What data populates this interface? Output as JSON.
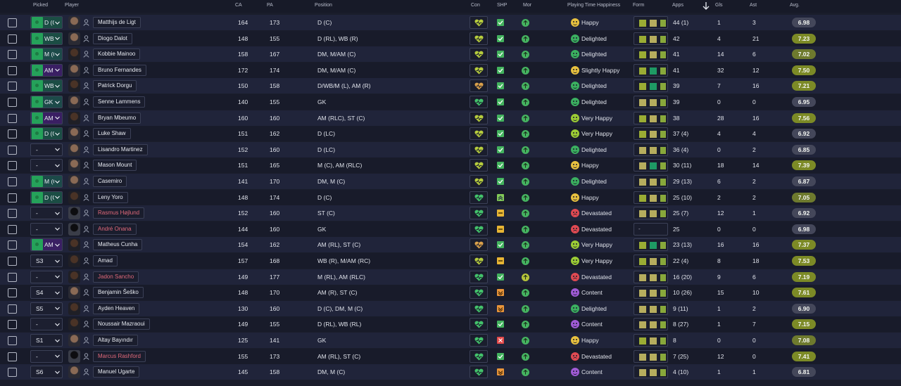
{
  "columns": {
    "picked": "Picked",
    "player": "Player",
    "ca": "CA",
    "pa": "PA",
    "position": "Position",
    "con": "Con",
    "shp": "SHP",
    "mor": "Mor",
    "happiness": "Playing Time Happiness",
    "form": "Form",
    "apps": "Apps",
    "gls": "Gls",
    "ast": "Ast",
    "avg": "Avg."
  },
  "sort": {
    "column": "apps",
    "direction": "descending"
  },
  "rows": [
    {
      "picked": "D (C",
      "picked_type": "d",
      "name": "Matthijs de Ligt",
      "name_red": false,
      "face": "light",
      "ca": "164",
      "pa": "173",
      "position": "D (C)",
      "con": "yellow-green",
      "shp": "ok",
      "mor": "g",
      "happiness": "Happy",
      "hap": "happy",
      "form": [
        "fg",
        "fy",
        "fl"
      ],
      "apps": "44 (1)",
      "gls": "1",
      "ast": "3",
      "avg": "6.98",
      "avg_level": "lo"
    },
    {
      "picked": "WB",
      "picked_type": "wb",
      "name": "Diogo Dalot",
      "name_red": false,
      "face": "light",
      "ca": "148",
      "pa": "155",
      "position": "D (RL), WB (R)",
      "con": "yellow-green",
      "shp": "ok",
      "mor": "g",
      "happiness": "Delighted",
      "hap": "delighted",
      "form": [
        "fg",
        "fy",
        "fl"
      ],
      "apps": "42",
      "gls": "4",
      "ast": "21",
      "avg": "7.23",
      "avg_level": "hi"
    },
    {
      "picked": "M (C",
      "picked_type": "m",
      "name": "Kobbie Mainoo",
      "name_red": false,
      "face": "dark",
      "ca": "158",
      "pa": "167",
      "position": "DM, M/AM (C)",
      "con": "yellow-green",
      "shp": "ok",
      "mor": "g",
      "happiness": "Delighted",
      "hap": "delighted",
      "form": [
        "fg",
        "fy",
        "fl"
      ],
      "apps": "41",
      "gls": "14",
      "ast": "6",
      "avg": "7.02",
      "avg_level": "mid"
    },
    {
      "picked": "AM",
      "picked_type": "am",
      "name": "Bruno Fernandes",
      "name_red": false,
      "face": "light",
      "ca": "172",
      "pa": "174",
      "position": "DM, M/AM (C)",
      "con": "yellow-green",
      "shp": "ok",
      "mor": "g",
      "happiness": "Slightly Happy",
      "hap": "slightly",
      "form": [
        "fg",
        "fd",
        "fl"
      ],
      "apps": "41",
      "gls": "32",
      "ast": "12",
      "avg": "7.50",
      "avg_level": "hi"
    },
    {
      "picked": "WB",
      "picked_type": "wb",
      "name": "Patrick Dorgu",
      "name_red": false,
      "face": "dark",
      "ca": "150",
      "pa": "158",
      "position": "D/WB/M (L), AM (R)",
      "con": "orange",
      "shp": "ok",
      "mor": "g",
      "happiness": "Delighted",
      "hap": "delighted",
      "form": [
        "fg",
        "fd",
        "fl"
      ],
      "apps": "39",
      "gls": "7",
      "ast": "16",
      "avg": "7.21",
      "avg_level": "hi"
    },
    {
      "picked": "GK",
      "picked_type": "gk",
      "name": "Senne Lammens",
      "name_red": false,
      "face": "light",
      "ca": "140",
      "pa": "155",
      "position": "GK",
      "con": "green",
      "shp": "ok",
      "mor": "g",
      "happiness": "Delighted",
      "hap": "delighted",
      "form": [
        "fy",
        "fy",
        "fl"
      ],
      "apps": "39",
      "gls": "0",
      "ast": "0",
      "avg": "6.95",
      "avg_level": "lo"
    },
    {
      "picked": "AM",
      "picked_type": "am",
      "name": "Bryan Mbeumo",
      "name_red": false,
      "face": "dark",
      "ca": "160",
      "pa": "160",
      "position": "AM (RLC), ST (C)",
      "con": "yellow-green",
      "shp": "ok",
      "mor": "g",
      "happiness": "Very Happy",
      "hap": "veryhappy",
      "form": [
        "fg",
        "fy",
        "fl"
      ],
      "apps": "38",
      "gls": "28",
      "ast": "16",
      "avg": "7.56",
      "avg_level": "hi"
    },
    {
      "picked": "D (C",
      "picked_type": "d",
      "name": "Luke Shaw",
      "name_red": false,
      "face": "light",
      "ca": "151",
      "pa": "162",
      "position": "D (LC)",
      "con": "yellow-green",
      "shp": "ok",
      "mor": "g",
      "happiness": "Very Happy",
      "hap": "veryhappy",
      "form": [
        "fg",
        "fy",
        "fl"
      ],
      "apps": "37 (4)",
      "gls": "4",
      "ast": "4",
      "avg": "6.92",
      "avg_level": "lo"
    },
    {
      "picked": "-",
      "picked_type": "empty",
      "name": "Lisandro Martinez",
      "name_red": false,
      "face": "light",
      "ca": "152",
      "pa": "160",
      "position": "D (LC)",
      "con": "yellow-green",
      "shp": "ok",
      "mor": "g",
      "happiness": "Delighted",
      "hap": "delighted",
      "form": [
        "fy",
        "fy",
        "fl"
      ],
      "apps": "36 (4)",
      "gls": "0",
      "ast": "2",
      "avg": "6.85",
      "avg_level": "lo"
    },
    {
      "picked": "-",
      "picked_type": "empty",
      "name": "Mason Mount",
      "name_red": false,
      "face": "light",
      "ca": "151",
      "pa": "165",
      "position": "M (C), AM (RLC)",
      "con": "yellow-green",
      "shp": "ok",
      "mor": "g",
      "happiness": "Happy",
      "hap": "happy",
      "form": [
        "fy",
        "fd",
        "fl"
      ],
      "apps": "30 (11)",
      "gls": "18",
      "ast": "14",
      "avg": "7.39",
      "avg_level": "hi"
    },
    {
      "picked": "M (C",
      "picked_type": "m",
      "name": "Casemiro",
      "name_red": false,
      "face": "light",
      "ca": "141",
      "pa": "170",
      "position": "DM, M (C)",
      "con": "yellow-green",
      "shp": "ok",
      "mor": "g",
      "happiness": "Delighted",
      "hap": "delighted",
      "form": [
        "fy",
        "fy",
        "fl"
      ],
      "apps": "29 (13)",
      "gls": "6",
      "ast": "2",
      "avg": "6.87",
      "avg_level": "lo"
    },
    {
      "picked": "D (C",
      "picked_type": "d",
      "name": "Leny Yoro",
      "name_red": false,
      "face": "dark",
      "ca": "148",
      "pa": "174",
      "position": "D (C)",
      "con": "green",
      "shp": "up",
      "mor": "g",
      "happiness": "Happy",
      "hap": "happy",
      "form": [
        "fg",
        "fy",
        "fl"
      ],
      "apps": "25 (10)",
      "gls": "2",
      "ast": "2",
      "avg": "7.05",
      "avg_level": "mid"
    },
    {
      "picked": "-",
      "picked_type": "empty",
      "name": "Rasmus Højlund",
      "name_red": true,
      "face": "sil",
      "ca": "152",
      "pa": "160",
      "position": "ST (C)",
      "con": "green",
      "shp": "mid",
      "mor": "g",
      "happiness": "Devastated",
      "hap": "devastated",
      "form": [
        "fy",
        "fy",
        "fl"
      ],
      "apps": "25 (7)",
      "gls": "12",
      "ast": "1",
      "avg": "6.92",
      "avg_level": "lo"
    },
    {
      "picked": "-",
      "picked_type": "empty",
      "name": "André Onana",
      "name_red": true,
      "face": "sil",
      "ca": "144",
      "pa": "160",
      "position": "GK",
      "con": "green",
      "shp": "mid",
      "mor": "g",
      "happiness": "Devastated",
      "hap": "devastated",
      "form": [],
      "apps": "25",
      "gls": "0",
      "ast": "0",
      "avg": "6.98",
      "avg_level": "lo"
    },
    {
      "picked": "AM",
      "picked_type": "am",
      "name": "Matheus Cunha",
      "name_red": false,
      "face": "dark",
      "ca": "154",
      "pa": "162",
      "position": "AM (RL), ST (C)",
      "con": "orange",
      "shp": "ok",
      "mor": "g",
      "happiness": "Very Happy",
      "hap": "veryhappy",
      "form": [
        "fg",
        "fd",
        "fl"
      ],
      "apps": "23 (13)",
      "gls": "16",
      "ast": "16",
      "avg": "7.37",
      "avg_level": "hi"
    },
    {
      "picked": "S3",
      "picked_type": "sub",
      "name": "Amad",
      "name_red": false,
      "face": "dark",
      "ca": "157",
      "pa": "168",
      "position": "WB (R), M/AM (RC)",
      "con": "yellow-green",
      "shp": "mid",
      "mor": "g",
      "happiness": "Very Happy",
      "hap": "veryhappy",
      "form": [
        "fg",
        "fy",
        "fl"
      ],
      "apps": "22 (4)",
      "gls": "8",
      "ast": "18",
      "avg": "7.53",
      "avg_level": "hi"
    },
    {
      "picked": "-",
      "picked_type": "empty",
      "name": "Jadon Sancho",
      "name_red": true,
      "face": "dark",
      "ca": "149",
      "pa": "177",
      "position": "M (RL), AM (RLC)",
      "con": "green",
      "shp": "ok",
      "mor": "y",
      "happiness": "Devastated",
      "hap": "devastated",
      "form": [
        "fy",
        "fy",
        "fl"
      ],
      "apps": "16 (20)",
      "gls": "9",
      "ast": "6",
      "avg": "7.19",
      "avg_level": "hi"
    },
    {
      "picked": "S4",
      "picked_type": "sub",
      "name": "Benjamin Šeško",
      "name_red": false,
      "face": "light",
      "ca": "148",
      "pa": "170",
      "position": "AM (R), ST (C)",
      "con": "green",
      "shp": "warn",
      "mor": "g",
      "happiness": "Content",
      "hap": "content",
      "form": [
        "fy",
        "fy",
        "fl"
      ],
      "apps": "10 (26)",
      "gls": "15",
      "ast": "10",
      "avg": "7.61",
      "avg_level": "hi"
    },
    {
      "picked": "S5",
      "picked_type": "sub",
      "name": "Ayden Heaven",
      "name_red": false,
      "face": "dark",
      "ca": "130",
      "pa": "160",
      "position": "D (C), DM, M (C)",
      "con": "green",
      "shp": "warn",
      "mor": "g",
      "happiness": "Delighted",
      "hap": "delighted",
      "form": [
        "fy",
        "fy",
        "fl"
      ],
      "apps": "9 (11)",
      "gls": "1",
      "ast": "2",
      "avg": "6.90",
      "avg_level": "lo"
    },
    {
      "picked": "-",
      "picked_type": "empty",
      "name": "Noussair Mazraoui",
      "name_red": false,
      "face": "dark",
      "ca": "149",
      "pa": "155",
      "position": "D (RL), WB (RL)",
      "con": "green",
      "shp": "ok",
      "mor": "g",
      "happiness": "Content",
      "hap": "content",
      "form": [
        "fy",
        "fy",
        "fl"
      ],
      "apps": "8 (27)",
      "gls": "1",
      "ast": "7",
      "avg": "7.15",
      "avg_level": "hi"
    },
    {
      "picked": "S1",
      "picked_type": "sub",
      "name": "Altay Bayındır",
      "name_red": false,
      "face": "light",
      "ca": "125",
      "pa": "141",
      "position": "GK",
      "con": "green",
      "shp": "bad",
      "mor": "g",
      "happiness": "Happy",
      "hap": "happy",
      "form": [
        "fg",
        "fy",
        "fl"
      ],
      "apps": "8",
      "gls": "0",
      "ast": "0",
      "avg": "7.08",
      "avg_level": "mid"
    },
    {
      "picked": "-",
      "picked_type": "empty",
      "name": "Marcus Rashford",
      "name_red": true,
      "face": "sil",
      "ca": "155",
      "pa": "173",
      "position": "AM (RL), ST (C)",
      "con": "green",
      "shp": "ok",
      "mor": "g",
      "happiness": "Devastated",
      "hap": "devastated",
      "form": [
        "fy",
        "fy",
        "fl"
      ],
      "apps": "7 (25)",
      "gls": "12",
      "ast": "0",
      "avg": "7.41",
      "avg_level": "hi"
    },
    {
      "picked": "S6",
      "picked_type": "sub",
      "name": "Manuel Ugarte",
      "name_red": false,
      "face": "light",
      "ca": "145",
      "pa": "158",
      "position": "DM, M (C)",
      "con": "green",
      "shp": "warn",
      "mor": "g",
      "happiness": "Content",
      "hap": "content",
      "form": [
        "fy",
        "fy",
        "fl"
      ],
      "apps": "4 (10)",
      "gls": "1",
      "ast": "1",
      "avg": "6.81",
      "avg_level": "lo"
    }
  ]
}
